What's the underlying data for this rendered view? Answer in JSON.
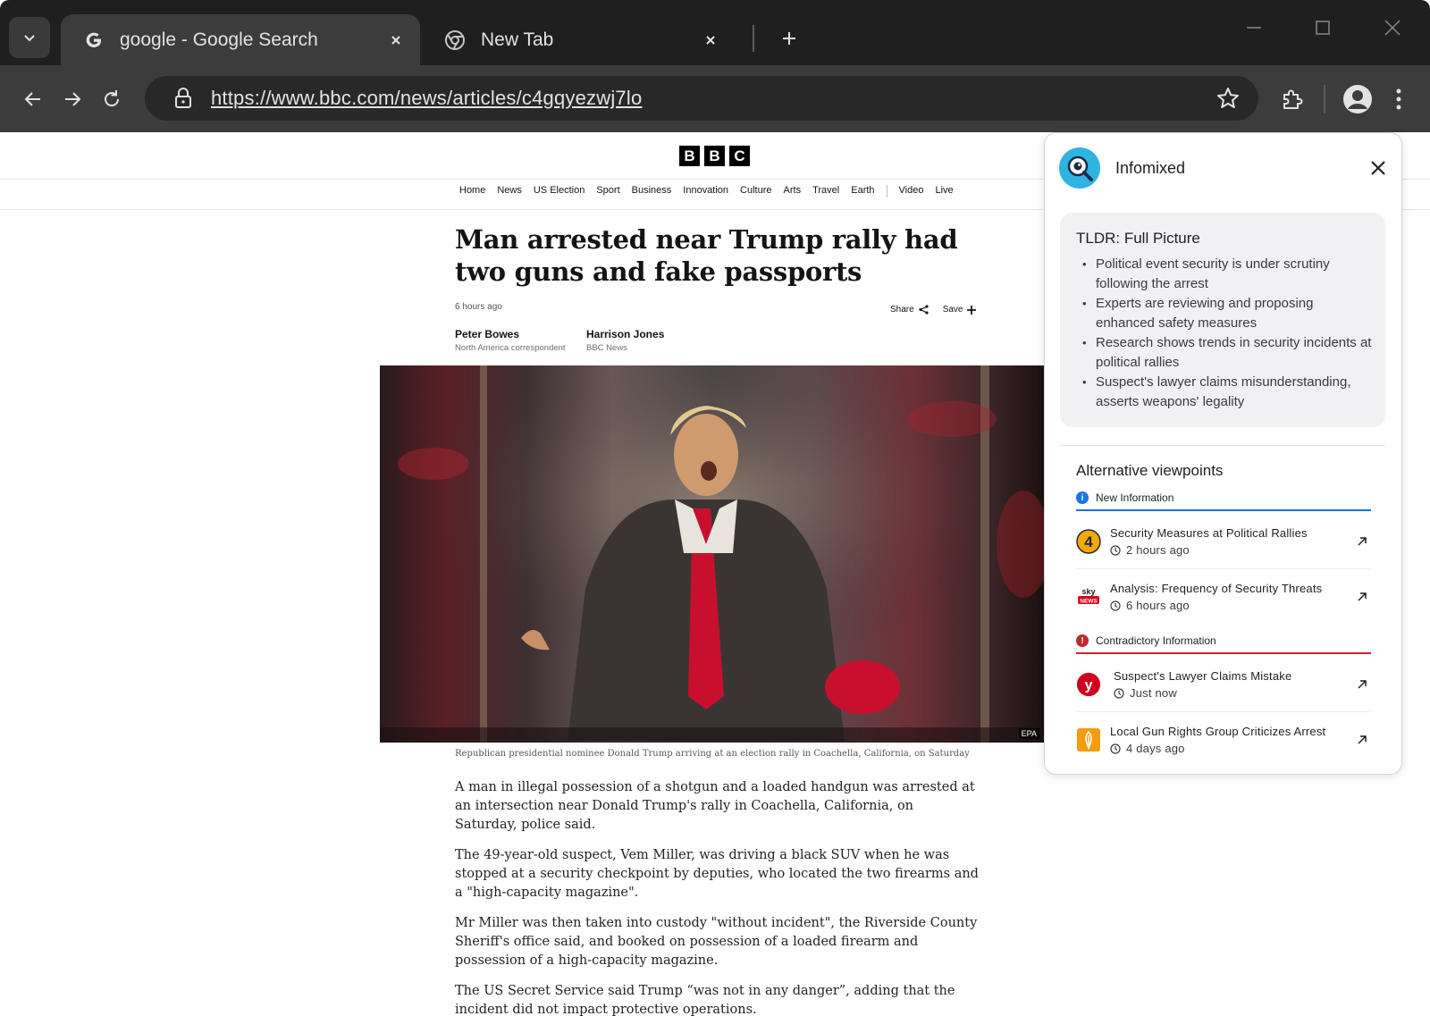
{
  "browser": {
    "tabs": [
      {
        "title": "google - Google Search",
        "favicon": "google-g-icon",
        "active": true
      },
      {
        "title": "New Tab",
        "favicon": "chrome-icon",
        "active": false
      }
    ],
    "url": "https://www.bbc.com/news/articles/c4gqyezwj7lo"
  },
  "bbc": {
    "logo": [
      "B",
      "B",
      "C"
    ],
    "nav": [
      "Home",
      "News",
      "US Election",
      "Sport",
      "Business",
      "Innovation",
      "Culture",
      "Arts",
      "Travel",
      "Earth",
      "Video",
      "Live"
    ],
    "headline": "Man arrested near Trump rally had two guns and fake passports",
    "timestamp": "6 hours ago",
    "share_label": "Share",
    "save_label": "Save",
    "authors": [
      {
        "name": "Peter Bowes",
        "role": "North America correspondent"
      },
      {
        "name": "Harrison Jones",
        "role": "BBC News"
      }
    ],
    "image_credit": "EPA",
    "caption": "Republican presidential nominee Donald Trump arriving at an election rally in Coachella, California, on Saturday",
    "paragraphs": [
      "A man in illegal possession of a shotgun and a loaded handgun was arrested at an intersection near Donald Trump's rally in Coachella, California, on Saturday, police said.",
      "The 49-year-old suspect, Vem Miller, was driving a black SUV when he was stopped at a security checkpoint by deputies, who located the two firearms and a \"high-capacity magazine\".",
      "Mr Miller was then taken into custody \"without incident\", the Riverside County Sheriff's office said, and booked on possession of a loaded firearm and possession of a high-capacity magazine.",
      "The US Secret Service said Trump “was not in any danger”, adding that the incident did not impact protective operations."
    ]
  },
  "panel": {
    "title": "Infomixed",
    "tldr_title": "TLDR: Full Picture",
    "tldr_items": [
      "Political event security is under scrutiny following the arrest",
      "Experts are reviewing and proposing enhanced safety measures",
      "Research shows trends in security incidents at political rallies",
      "Suspect's lawyer claims misunderstanding, asserts weapons' legality"
    ],
    "alt_title": "Alternative viewpoints",
    "sections": [
      {
        "label": "New Information",
        "color": "#1a73e8",
        "items": [
          {
            "title": "Security Measures at Political Rallies",
            "time": "2 hours ago",
            "source_icon": "channel-4-icon"
          },
          {
            "title": "Analysis: Frequency of Security Threats",
            "time": "6 hours ago",
            "source_icon": "sky-news-icon"
          }
        ]
      },
      {
        "label": "Contradictory Information",
        "color": "#c62828",
        "items": [
          {
            "title": "Suspect's Lawyer Claims Mistake",
            "time": "Just now",
            "source_icon": "ynet-icon"
          },
          {
            "title": "Local Gun Rights Group Criticizes Arrest",
            "time": "4 days ago",
            "source_icon": "news-source-icon"
          }
        ]
      }
    ]
  }
}
